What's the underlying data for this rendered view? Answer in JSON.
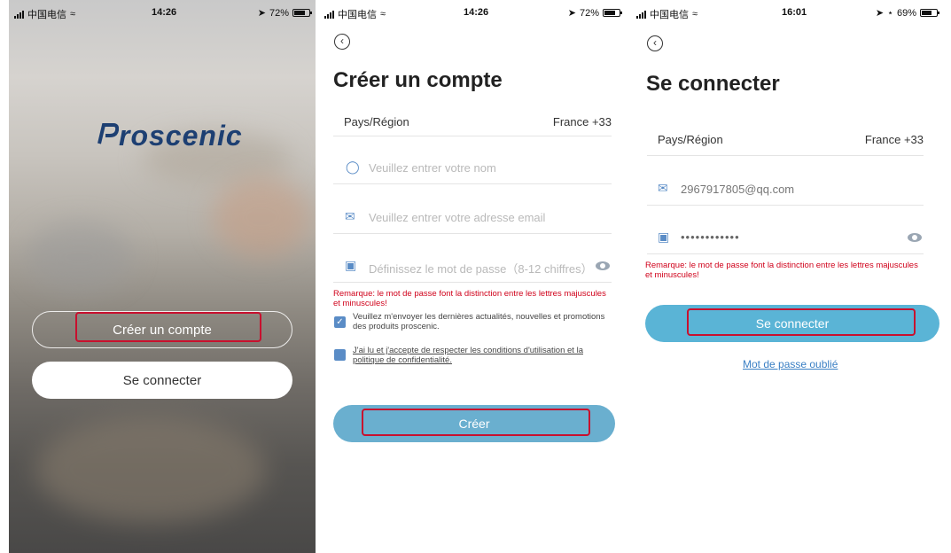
{
  "status_bars": [
    {
      "carrier": "中国电信",
      "time": "14:26",
      "battery": "72%"
    },
    {
      "carrier": "中国电信",
      "time": "14:26",
      "battery": "72%"
    },
    {
      "carrier": "中国电信",
      "time": "16:01",
      "battery": "69%"
    }
  ],
  "welcome": {
    "logo_text": "roscenic",
    "create_account_label": "Créer un compte",
    "login_label": "Se connecter"
  },
  "register": {
    "title": "Créer un compte",
    "region_label": "Pays/Région",
    "region_value": "France +33",
    "name_placeholder": "Veuillez entrer votre nom",
    "email_placeholder": "Veuillez entrer votre adresse email",
    "password_placeholder": "Définissez le mot de passe（8-12 chiffres）",
    "remark": "Remarque: le mot de passe font la distinction entre les lettres majuscules et minuscules!",
    "newsletter_text": "Veuillez m'envoyer les dernières actualités, nouvelles et promotions des produits proscenic.",
    "terms_text": "J'ai lu et j'accepte de respecter les conditions d'utilisation et la politique de confidentialité.",
    "submit_label": "Créer"
  },
  "login": {
    "title": "Se connecter",
    "region_label": "Pays/Région",
    "region_value": "France +33",
    "email_value": "2967917805@qq.com",
    "password_value": "••••••••••••",
    "remark": "Remarque: le mot de passe font la distinction entre les lettres majuscules et minuscules!",
    "submit_label": "Se connecter",
    "forgot_label": "Mot de passe oublié"
  },
  "colors": {
    "accent": "#5ab4d6",
    "accent_dim": "#6aafcf",
    "icon": "#5a8cc6",
    "warning": "#d0021b",
    "highlight_box": "#c8102e"
  },
  "icons": [
    "signal-icon",
    "wifi-icon",
    "location-icon",
    "battery-icon",
    "back-icon",
    "user-icon",
    "mail-icon",
    "lock-icon",
    "eye-icon",
    "check-icon"
  ]
}
